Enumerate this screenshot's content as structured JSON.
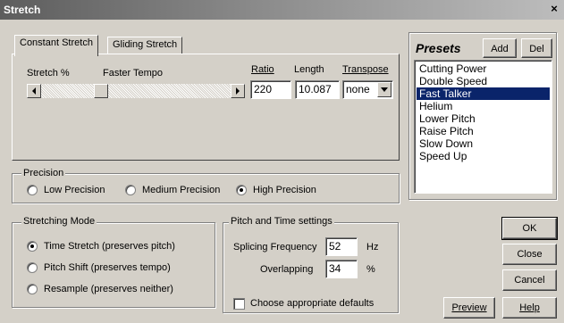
{
  "window": {
    "title": "Stretch",
    "close_glyph": "×"
  },
  "tabs": [
    {
      "label": "Constant Stretch",
      "active": true
    },
    {
      "label": "Gliding Stretch",
      "active": false
    }
  ],
  "stretch": {
    "label": "Stretch %",
    "tempo_label": "Faster Tempo",
    "ratio_label": "Ratio",
    "length_label": "Length",
    "transpose_label": "Transpose",
    "ratio": "220",
    "length": "10.087",
    "transpose": "none",
    "slider_position": 0.3
  },
  "precision": {
    "legend": "Precision",
    "options": [
      {
        "label": "Low Precision",
        "selected": false
      },
      {
        "label": "Medium Precision",
        "selected": false
      },
      {
        "label": "High Precision",
        "selected": true
      }
    ]
  },
  "mode": {
    "legend": "Stretching Mode",
    "options": [
      {
        "label": "Time Stretch (preserves pitch)",
        "selected": true
      },
      {
        "label": "Pitch Shift (preserves tempo)",
        "selected": false
      },
      {
        "label": "Resample (preserves neither)",
        "selected": false
      }
    ]
  },
  "pitch_time": {
    "legend": "Pitch and Time settings",
    "splicing_label": "Splicing Frequency",
    "splicing_value": "52",
    "splicing_unit": "Hz",
    "overlapping_label": "Overlapping",
    "overlapping_value": "34",
    "overlapping_unit": "%",
    "defaults_label": "Choose appropriate defaults",
    "defaults_checked": false
  },
  "presets": {
    "title": "Presets",
    "add_label": "Add",
    "del_label": "Del",
    "items": [
      "Cutting Power",
      "Double Speed",
      "Fast Talker",
      "Helium",
      "Lower Pitch",
      "Raise Pitch",
      "Slow Down",
      "Speed Up"
    ],
    "selected": "Fast Talker"
  },
  "buttons": {
    "ok": "OK",
    "close": "Close",
    "cancel": "Cancel",
    "preview": "Preview",
    "help": "Help"
  }
}
